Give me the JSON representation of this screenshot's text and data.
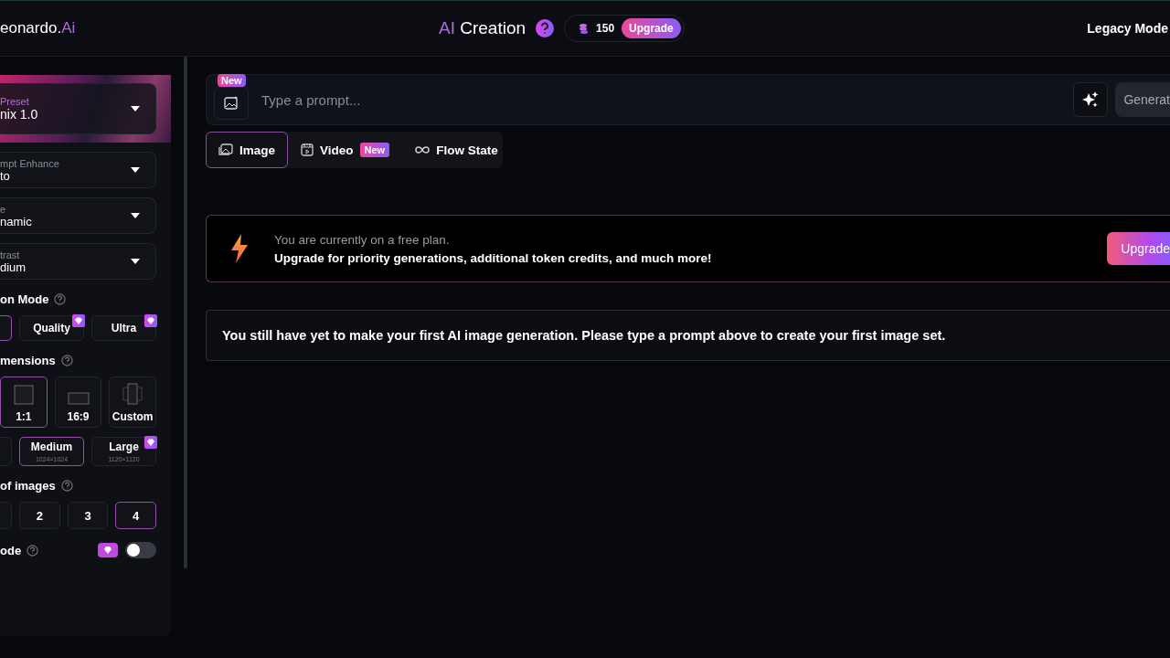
{
  "header": {
    "logo": {
      "text": "eonardo.",
      "accent": "Ai"
    },
    "title": {
      "accent": "AI",
      "text": "Creation"
    },
    "tokens": "150",
    "upgrade": "Upgrade",
    "legacy": "Legacy Mode"
  },
  "sidebar": {
    "preset": {
      "label": "Preset",
      "value": "nix 1.0"
    },
    "selects": [
      {
        "label": "mpt Enhance",
        "value": "to"
      },
      {
        "label": "e",
        "value": "namic"
      },
      {
        "label": "trast",
        "value": "dium"
      }
    ],
    "generation_mode": {
      "title": "on Mode",
      "options": [
        {
          "selected": true
        },
        {
          "label": "Quality",
          "premium": true,
          "selected": false
        },
        {
          "label": "Ultra",
          "premium": true,
          "selected": false
        }
      ]
    },
    "dimensions": {
      "title": "mensions",
      "ratios": [
        {
          "label": "1:1",
          "kind": "square",
          "selected": true
        },
        {
          "label": "16:9",
          "kind": "wide",
          "selected": false
        },
        {
          "label": "Custom",
          "kind": "custom",
          "selected": false
        }
      ],
      "sizes": [
        {
          "selected": false
        },
        {
          "label": "Medium",
          "detail": "1024×1024",
          "premium": false,
          "selected": true
        },
        {
          "label": "Large",
          "detail": "1120×1120",
          "premium": true,
          "selected": false
        }
      ]
    },
    "images": {
      "title": "of images",
      "counts": [
        {
          "selected": false
        },
        {
          "label": "2",
          "selected": false
        },
        {
          "label": "3",
          "selected": false
        },
        {
          "label": "4",
          "selected": true
        }
      ]
    },
    "private_mode": {
      "title": "ode",
      "on": false
    }
  },
  "prompt": {
    "badge": "New",
    "placeholder": "Type a prompt...",
    "generate": "Generat"
  },
  "tabs": [
    {
      "label": "Image",
      "selected": true
    },
    {
      "label": "Video",
      "badge": "New",
      "selected": false
    },
    {
      "label": "Flow State",
      "selected": false
    }
  ],
  "banner": {
    "line1": "You are currently on a free plan.",
    "line2": "Upgrade for priority generations, additional token credits, and much more!",
    "button": "Upgrade"
  },
  "empty_message": "You still have yet to make your first AI image generation. Please type a prompt above to create your first image set."
}
